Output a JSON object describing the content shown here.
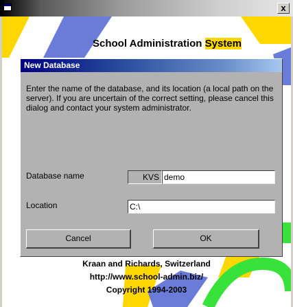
{
  "window": {
    "close_label": "x"
  },
  "banner": {
    "title_part1": "School Administration ",
    "title_part2": "System"
  },
  "dialog": {
    "title": "New Database",
    "description": "Enter the name of the database, and its location (a local path on the server). If you are uncertain of the correct setting, please cancel this dialog and contact your system administrator.",
    "database_name_label": "Database name",
    "database_prefix": "KVS",
    "database_name_value": "demo",
    "location_label": "Location",
    "location_value": "C:\\",
    "cancel_label": "Cancel",
    "ok_label": "OK"
  },
  "footer": {
    "company": "Kraan and Richards, Switzerland",
    "url": "http://www.school-admin.biz/",
    "copyright": "Copyright 1994-2003"
  },
  "colors": {
    "dialog_title_start": "#000080",
    "dialog_title_end": "#a6c8f0",
    "accent_yellow": "#ffd700",
    "accent_blue": "#6a7bd8",
    "accent_green": "#39e23a"
  }
}
